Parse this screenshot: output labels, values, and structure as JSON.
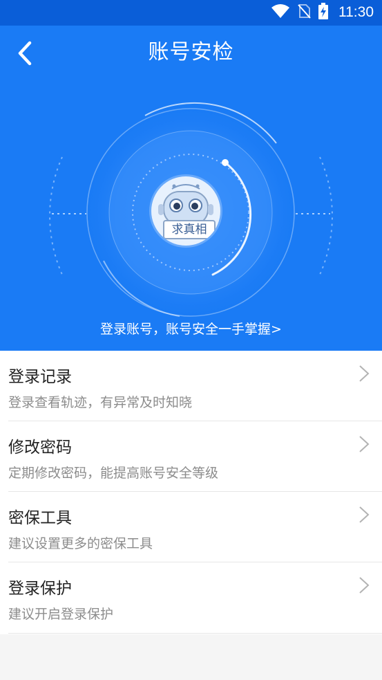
{
  "status_bar": {
    "time": "11:30",
    "icons": [
      "wifi-icon",
      "no-sim-icon",
      "battery-charging-icon"
    ]
  },
  "header": {
    "title": "账号安检",
    "back_icon": "chevron-left-icon"
  },
  "hero": {
    "mascot_label": "求真相",
    "link_text": "登录账号，账号安全一手掌握>"
  },
  "items": [
    {
      "title": "登录记录",
      "desc": "登录查看轨迹，有异常及时知晓"
    },
    {
      "title": "修改密码",
      "desc": "定期修改密码，能提高账号安全等级"
    },
    {
      "title": "密保工具",
      "desc": "建议设置更多的密保工具"
    },
    {
      "title": "登录保护",
      "desc": "建议开启登录保护"
    }
  ],
  "colors": {
    "status_bar": "#0a5ed8",
    "hero_bg": "#1a7bf5",
    "text_primary": "#222222",
    "text_secondary": "#8c8c8c"
  }
}
